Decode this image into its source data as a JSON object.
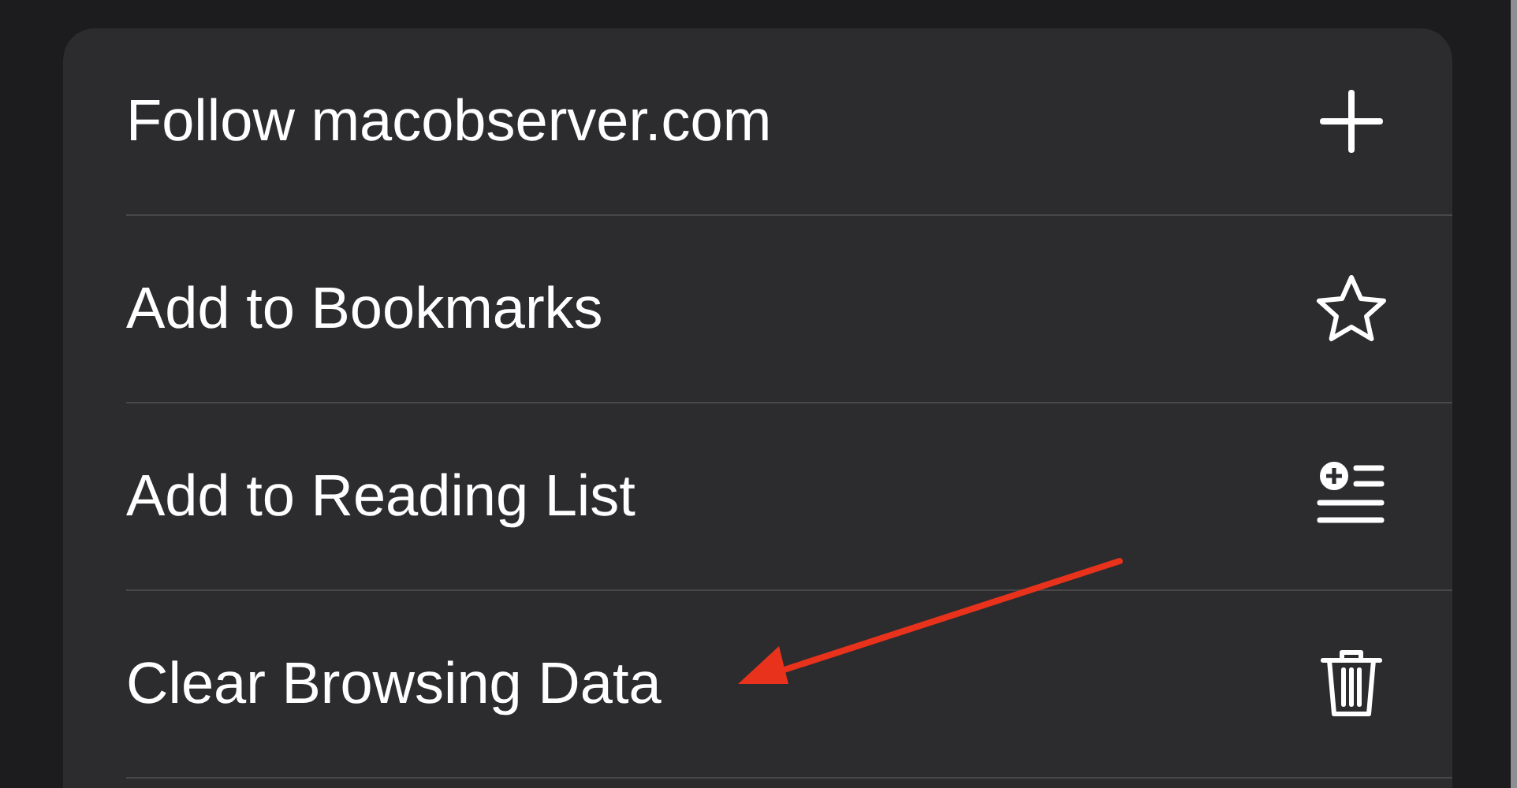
{
  "menu": {
    "items": [
      {
        "label": "Follow macobserver.com"
      },
      {
        "label": "Add to Bookmarks"
      },
      {
        "label": "Add to Reading List"
      },
      {
        "label": "Clear Browsing Data"
      }
    ]
  }
}
